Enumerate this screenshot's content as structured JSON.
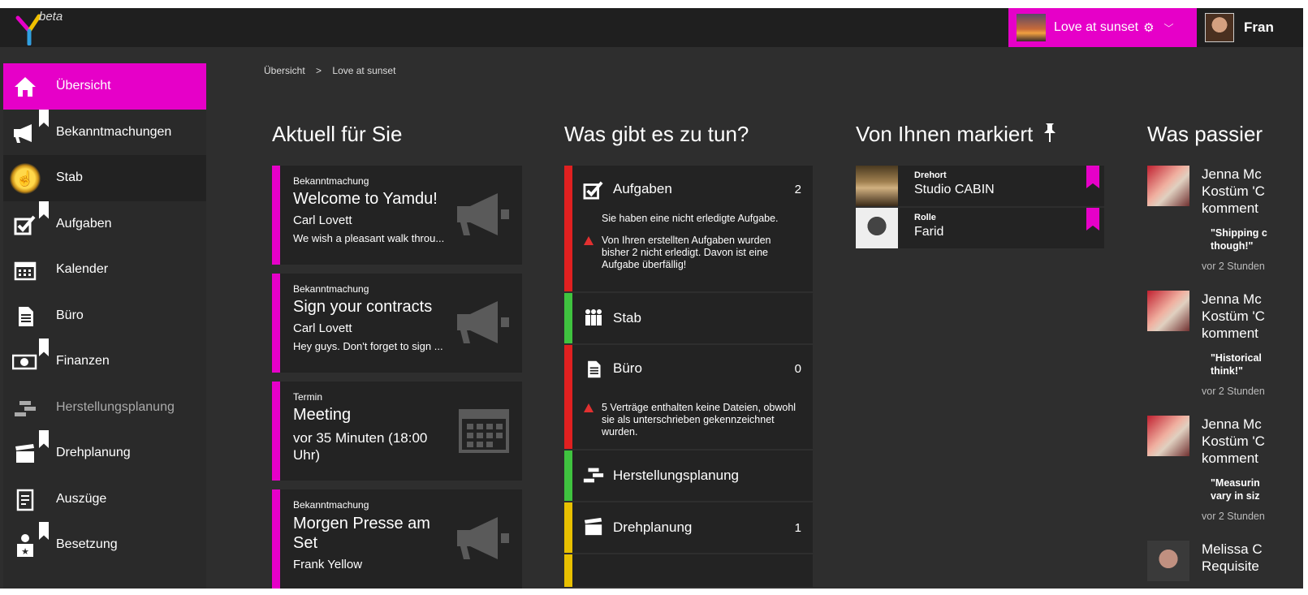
{
  "app": {
    "beta_label": "beta"
  },
  "header": {
    "project_name": "Love at sunset",
    "user_name": "Fran"
  },
  "sidebar": {
    "items": [
      {
        "label": "Übersicht",
        "icon": "home-icon"
      },
      {
        "label": "Bekanntmachungen",
        "icon": "megaphone-icon"
      },
      {
        "label": "Stab",
        "icon": "people-icon"
      },
      {
        "label": "Aufgaben",
        "icon": "checkbox-icon"
      },
      {
        "label": "Kalender",
        "icon": "calendar-icon"
      },
      {
        "label": "Büro",
        "icon": "documents-icon"
      },
      {
        "label": "Finanzen",
        "icon": "money-icon"
      },
      {
        "label": "Herstellungsplanung",
        "icon": "blocks-icon"
      },
      {
        "label": "Drehplanung",
        "icon": "clapperboard-icon"
      },
      {
        "label": "Auszüge",
        "icon": "notebook-icon"
      },
      {
        "label": "Besetzung",
        "icon": "star-person-icon"
      }
    ]
  },
  "breadcrumb": {
    "root": "Übersicht",
    "separator": ">",
    "current": "Love at sunset"
  },
  "columns": {
    "current": "Aktuell für Sie",
    "todo": "Was gibt es zu tun?",
    "marked": "Von Ihnen markiert",
    "happening": "Was passier"
  },
  "cards": [
    {
      "category": "Bekanntmachung",
      "title": "Welcome to Yamdu!",
      "author": "Carl Lovett",
      "text": "We wish a pleasant walk throu..."
    },
    {
      "category": "Bekanntmachung",
      "title": "Sign your contracts",
      "author": "Carl Lovett",
      "text": "Hey guys. Don't forget to sign ..."
    },
    {
      "category": "Termin",
      "title": "Meeting",
      "author": "vor 35 Minuten (18:00 Uhr)",
      "text": ""
    },
    {
      "category": "Bekanntmachung",
      "title": "Morgen Presse am Set",
      "author": "Frank Yellow",
      "text": ""
    }
  ],
  "todos": [
    {
      "label": "Aufgaben",
      "count": "2",
      "color": "#e02020",
      "lines": [
        "Sie haben eine nicht erledigte Aufgabe.",
        "Von Ihren erstellten Aufgaben wurden bisher 2 nicht erledigt. Davon ist eine Aufgabe überfällig!"
      ]
    },
    {
      "label": "Stab",
      "count": "",
      "color": "#3fc33f",
      "lines": []
    },
    {
      "label": "Büro",
      "count": "0",
      "color": "#e02020",
      "lines": [
        "5 Verträge enthalten keine Dateien, obwohl sie als unterschrieben gekennzeichnet wurden."
      ]
    },
    {
      "label": "Herstellungsplanung",
      "count": "",
      "color": "#3fc33f",
      "lines": []
    },
    {
      "label": "Drehplanung",
      "count": "1",
      "color": "#e8c000",
      "lines": []
    }
  ],
  "marked": [
    {
      "type": "Drehort",
      "name": "Studio CABIN"
    },
    {
      "type": "Rolle",
      "name": "Farid"
    }
  ],
  "feed": [
    {
      "name1": "Jenna Mc",
      "name2": "Kostüm 'C",
      "name3": "komment",
      "quote1": "\"Shipping c",
      "quote2": "though!\"",
      "time": "vor 2 Stunden"
    },
    {
      "name1": "Jenna Mc",
      "name2": "Kostüm 'C",
      "name3": "komment",
      "quote1": "\"Historical",
      "quote2": "think!\"",
      "time": "vor 2 Stunden"
    },
    {
      "name1": "Jenna Mc",
      "name2": "Kostüm 'C",
      "name3": "komment",
      "quote1": "\"Measurin",
      "quote2": "vary in siz",
      "time": "vor 2 Stunden"
    },
    {
      "name1": "Melissa C",
      "name2": "Requisite",
      "name3": "",
      "quote1": "",
      "quote2": "",
      "time": ""
    }
  ],
  "colors": {
    "accent": "#e600c8",
    "red": "#e02020",
    "green": "#3fc33f",
    "yellow": "#e8c000"
  }
}
